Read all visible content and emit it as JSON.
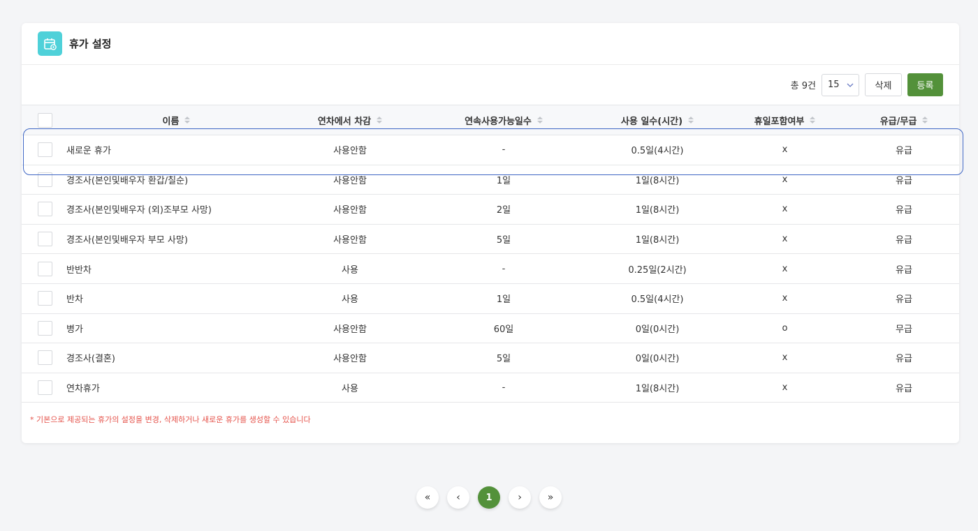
{
  "header": {
    "title": "휴가 설정",
    "icon": "calendar-gear-icon"
  },
  "toolbar": {
    "total_text": "총 9건",
    "page_size": "15",
    "delete_label": "삭제",
    "register_label": "등록",
    "accent_color": "#53913a"
  },
  "table": {
    "columns": [
      "이름",
      "연차에서 차감",
      "연속사용가능일수",
      "사용 일수(시간)",
      "휴일포함여부",
      "유급/무급"
    ],
    "rows": [
      [
        "새로운 휴가",
        "사용안함",
        "-",
        "0.5일(4시간)",
        "x",
        "유급"
      ],
      [
        "경조사(본인및배우자 환갑/칠순)",
        "사용안함",
        "1일",
        "1일(8시간)",
        "x",
        "유급"
      ],
      [
        "경조사(본인및배우자 (외)조부모 사망)",
        "사용안함",
        "2일",
        "1일(8시간)",
        "x",
        "유급"
      ],
      [
        "경조사(본인및배우자 부모 사망)",
        "사용안함",
        "5일",
        "1일(8시간)",
        "x",
        "유급"
      ],
      [
        "반반차",
        "사용",
        "-",
        "0.25일(2시간)",
        "x",
        "유급"
      ],
      [
        "반차",
        "사용",
        "1일",
        "0.5일(4시간)",
        "x",
        "유급"
      ],
      [
        "병가",
        "사용안함",
        "60일",
        "0일(0시간)",
        "o",
        "무급"
      ],
      [
        "경조사(결혼)",
        "사용안함",
        "5일",
        "0일(0시간)",
        "x",
        "유급"
      ],
      [
        "연차휴가",
        "사용",
        "-",
        "1일(8시간)",
        "x",
        "유급"
      ]
    ]
  },
  "notice": "* 기본으로 제공되는 휴가의 설정을 변경, 삭제하거나 새로운 휴가를 생성할 수 있습니다",
  "pagination": {
    "first": "«",
    "prev": "‹",
    "current": "1",
    "next": "›",
    "last": "»"
  }
}
